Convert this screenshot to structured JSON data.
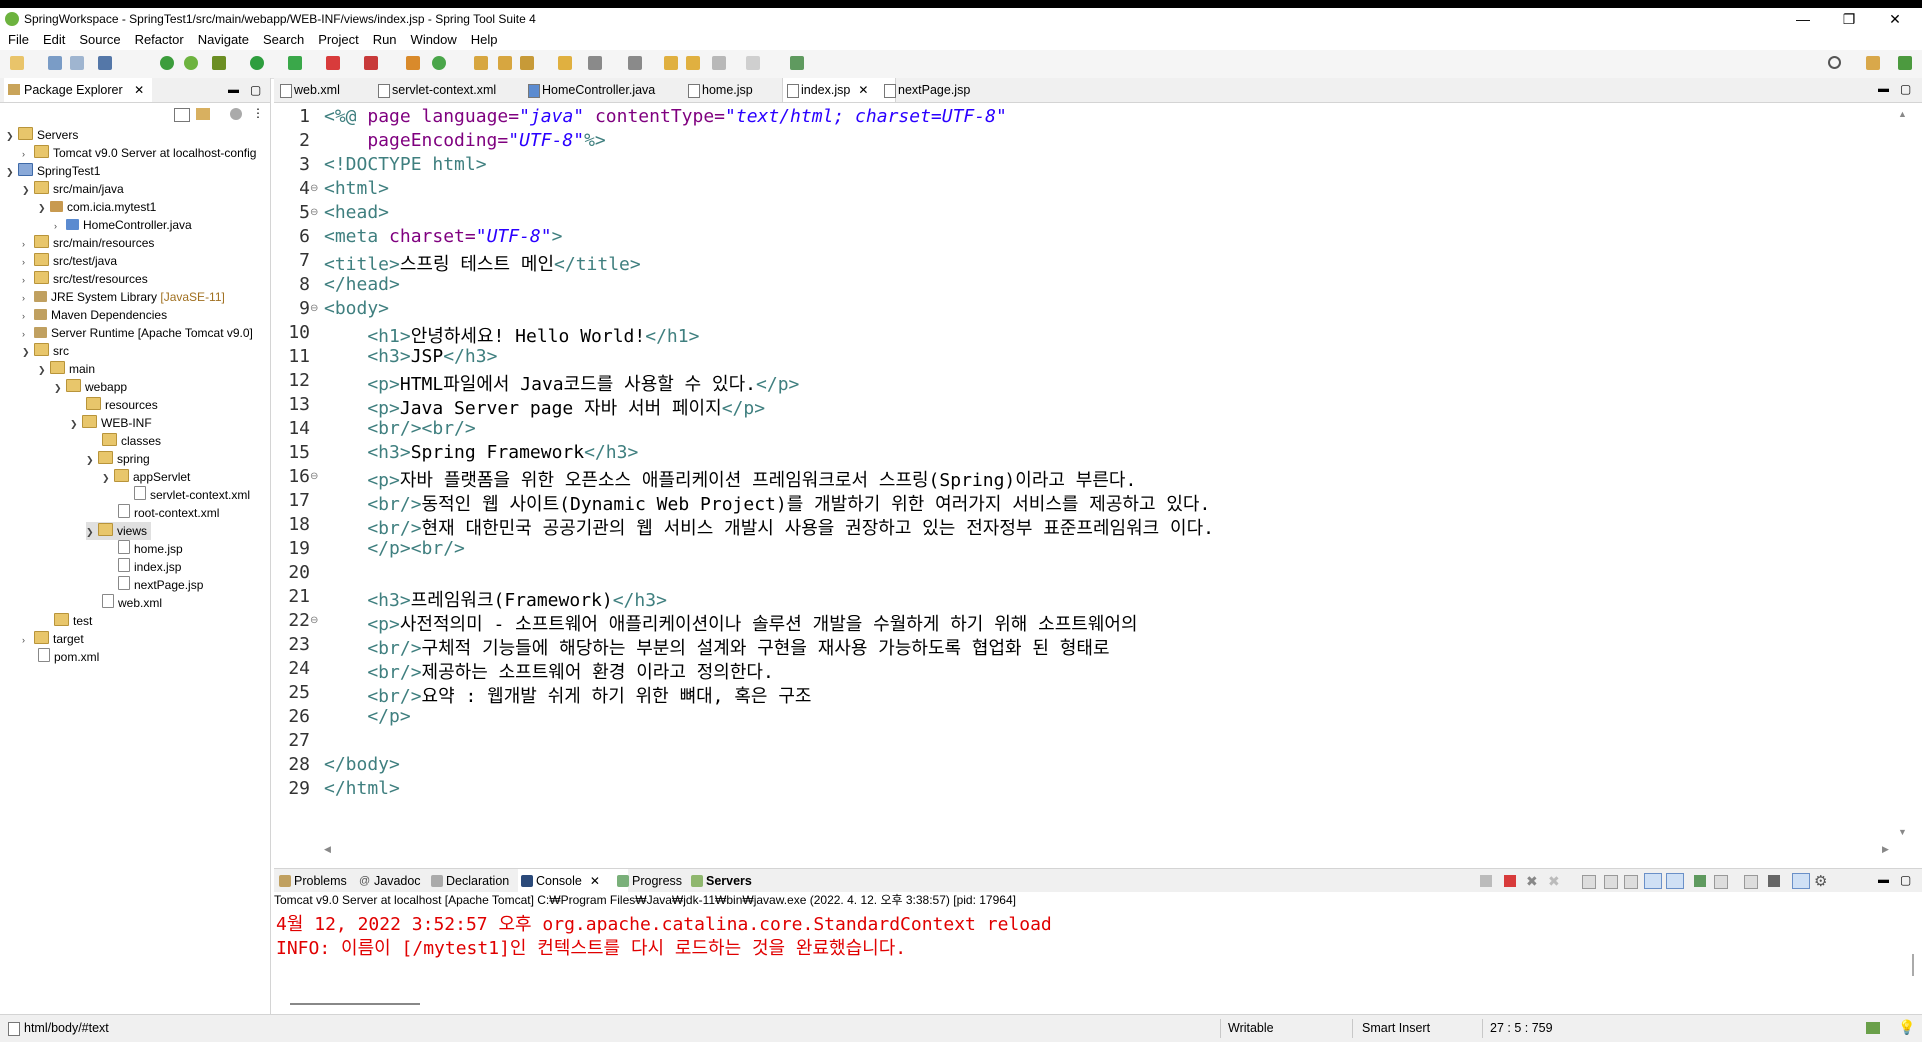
{
  "window": {
    "title": "SpringWorkspace - SpringTest1/src/main/webapp/WEB-INF/views/index.jsp - Spring Tool Suite 4",
    "minimize": "—",
    "maximize": "❐",
    "close": "✕"
  },
  "menu": [
    "File",
    "Edit",
    "Source",
    "Refactor",
    "Navigate",
    "Search",
    "Project",
    "Run",
    "Window",
    "Help"
  ],
  "explorer": {
    "tab_label": "Package Explorer",
    "tree": [
      {
        "label": "Servers",
        "icon": "folder-icon"
      },
      {
        "label": "Tomcat v9.0 Server at localhost-config",
        "icon": "folder-icon"
      },
      {
        "label": "SpringTest1",
        "icon": "project-icon"
      },
      {
        "label": "src/main/java",
        "icon": "source-folder-icon"
      },
      {
        "label": "com.icia.mytest1",
        "icon": "package-icon"
      },
      {
        "label": "HomeController.java",
        "icon": "java-file-icon"
      },
      {
        "label": "src/main/resources",
        "icon": "source-folder-icon"
      },
      {
        "label": "src/test/java",
        "icon": "source-folder-icon"
      },
      {
        "label": "src/test/resources",
        "icon": "source-folder-icon"
      },
      {
        "label": "JRE System Library",
        "suffix": "[JavaSE-11]",
        "icon": "library-icon"
      },
      {
        "label": "Maven Dependencies",
        "icon": "library-icon"
      },
      {
        "label": "Server Runtime [Apache Tomcat v9.0]",
        "icon": "library-icon"
      },
      {
        "label": "src",
        "icon": "folder-icon"
      },
      {
        "label": "main",
        "icon": "folder-icon"
      },
      {
        "label": "webapp",
        "icon": "folder-icon"
      },
      {
        "label": "resources",
        "icon": "folder-icon"
      },
      {
        "label": "WEB-INF",
        "icon": "folder-icon"
      },
      {
        "label": "classes",
        "icon": "folder-icon"
      },
      {
        "label": "spring",
        "icon": "folder-icon"
      },
      {
        "label": "appServlet",
        "icon": "folder-icon"
      },
      {
        "label": "servlet-context.xml",
        "icon": "xml-file-icon"
      },
      {
        "label": "root-context.xml",
        "icon": "xml-file-icon"
      },
      {
        "label": "views",
        "icon": "folder-icon"
      },
      {
        "label": "home.jsp",
        "icon": "jsp-file-icon"
      },
      {
        "label": "index.jsp",
        "icon": "jsp-file-icon"
      },
      {
        "label": "nextPage.jsp",
        "icon": "jsp-file-icon"
      },
      {
        "label": "web.xml",
        "icon": "xml-file-icon"
      },
      {
        "label": "test",
        "icon": "folder-icon"
      },
      {
        "label": "target",
        "icon": "folder-icon"
      },
      {
        "label": "pom.xml",
        "icon": "xml-file-icon"
      }
    ]
  },
  "editor": {
    "tabs": [
      "web.xml",
      "servlet-context.xml",
      "HomeController.java",
      "home.jsp",
      "index.jsp",
      "nextPage.jsp"
    ],
    "active_tab": "index.jsp",
    "line_numbers": [
      "1",
      "2",
      "3",
      "4",
      "5",
      "6",
      "7",
      "8",
      "9",
      "10",
      "11",
      "12",
      "13",
      "14",
      "15",
      "16",
      "17",
      "18",
      "19",
      "20",
      "21",
      "22",
      "23",
      "24",
      "25",
      "26",
      "27",
      "28",
      "29"
    ],
    "lines": {
      "l1a": "<%@ ",
      "l1b": "page ",
      "l1c": "language=",
      "l1d": "\"java\"",
      "l1e": " contentType=",
      "l1f": "\"text/html; charset=UTF-8\"",
      "l2a": "    pageEncoding=",
      "l2b": "\"UTF-8\"",
      "l2c": "%>",
      "l3": "<!DOCTYPE html>",
      "l4": "<html>",
      "l5": "<head>",
      "l6a": "<meta ",
      "l6b": "charset=",
      "l6c": "\"UTF-8\"",
      "l6d": ">",
      "l7a": "<title>",
      "l7b": "스프링 테스트 메인",
      "l7c": "</title>",
      "l8": "</head>",
      "l9": "<body>",
      "l10a": "    <h1>",
      "l10b": "안녕하세요! Hello World!",
      "l10c": "</h1>",
      "l11a": "    <h3>",
      "l11b": "JSP",
      "l11c": "</h3>",
      "l12a": "    <p>",
      "l12b": "HTML파일에서 Java코드를 사용할 수 있다.",
      "l12c": "</p>",
      "l13a": "    <p>",
      "l13b": "Java Server page 자바 서버 페이지",
      "l13c": "</p>",
      "l14": "    <br/><br/>",
      "l15a": "    <h3>",
      "l15b": "Spring Framework",
      "l15c": "</h3>",
      "l16a": "    <p>",
      "l16b": "자바 플랫폼을 위한 오픈소스 애플리케이션 프레임워크로서 스프링(Spring)이라고 부른다.",
      "l17a": "    <br/>",
      "l17b": "동적인 웹 사이트(Dynamic Web Project)를 개발하기 위한 여러가지 서비스를 제공하고 있다.",
      "l18a": "    <br/>",
      "l18b": "현재 대한민국 공공기관의 웹 서비스 개발시 사용을 권장하고 있는 전자정부 표준프레임워크 이다.",
      "l19": "    </p><br/>",
      "l20": "",
      "l21a": "    <h3>",
      "l21b": "프레임워크(Framework)",
      "l21c": "</h3>",
      "l22a": "    <p>",
      "l22b": "사전적의미 - 소프트웨어 애플리케이션이나 솔루션 개발을 수월하게 하기 위해 소프트웨어의",
      "l23a": "    <br/>",
      "l23b": "구체적 기능들에 해당하는 부분의 설계와 구현을 재사용 가능하도록 협업화 된 형태로",
      "l24a": "    <br/>",
      "l24b": "제공하는 소프트웨어 환경 이라고 정의한다.",
      "l25a": "    <br/>",
      "l25b": "요약 : 웹개발 쉬게 하기 위한 뼈대, 혹은 구조",
      "l26": "    </p>",
      "l27": "",
      "l28": "</body>",
      "l29": "</html>"
    }
  },
  "bottom": {
    "tabs": [
      "Problems",
      "Javadoc",
      "Declaration",
      "Console",
      "Progress",
      "Servers"
    ],
    "active_tab": "Console",
    "console_desc": "Tomcat v9.0 Server at localhost [Apache Tomcat] C:₩Program Files₩Java₩jdk-11₩bin₩javaw.exe  (2022. 4. 12. 오후 3:38:57) [pid: 17964]",
    "console_lines": [
      "4월 12, 2022 3:52:57 오후 org.apache.catalina.core.StandardContext reload",
      "INFO: 이름이 [/mytest1]인 컨텍스트를 다시 로드하는 것을 완료했습니다."
    ]
  },
  "status": {
    "path": "html/body/#text",
    "writable": "Writable",
    "insert_mode": "Smart Insert",
    "position": "27 : 5 : 759"
  },
  "colors": {
    "tag": "#3f7f7f",
    "attribute": "#7f007f",
    "string": "#2a00ff",
    "console_error": "#e00000",
    "current_line": "#e8f2fe"
  }
}
